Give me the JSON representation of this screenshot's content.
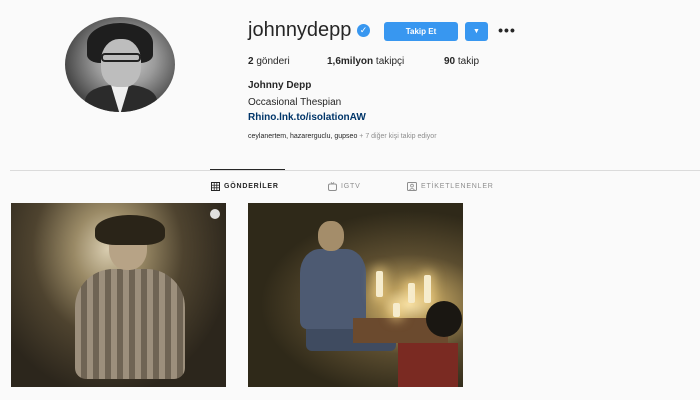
{
  "profile": {
    "username": "johnnydepp",
    "verified_icon": "verified-badge-icon",
    "follow_label": "Takip Et",
    "dropdown_icon": "chevron-down-icon",
    "more_icon": "more-options-icon",
    "stats": {
      "posts_count": "2",
      "posts_label": "gönderi",
      "followers_count": "1,6milyon",
      "followers_label": "takipçi",
      "following_count": "90",
      "following_label": "takip"
    },
    "full_name": "Johnny Depp",
    "bio": "Occasional Thespian",
    "link": "Rhino.lnk.to/isolationAW",
    "followed_by_names": "ceylanertem, hazarerguclu, gupseo",
    "followed_by_suffix": "+ 7 diğer kişi takip ediyor"
  },
  "tabs": [
    {
      "label": "GÖNDERİLER",
      "icon": "grid-icon",
      "active": true
    },
    {
      "label": "IGTV",
      "icon": "igtv-icon",
      "active": false
    },
    {
      "label": "ETİKETLENENLER",
      "icon": "tagged-icon",
      "active": false
    }
  ],
  "posts": [
    {
      "icon": "multiple-photos-icon"
    },
    {}
  ],
  "colors": {
    "accent": "#3897f0",
    "text": "#262626",
    "muted": "#8e8e8e",
    "link": "#003569",
    "background": "#fafafa"
  }
}
